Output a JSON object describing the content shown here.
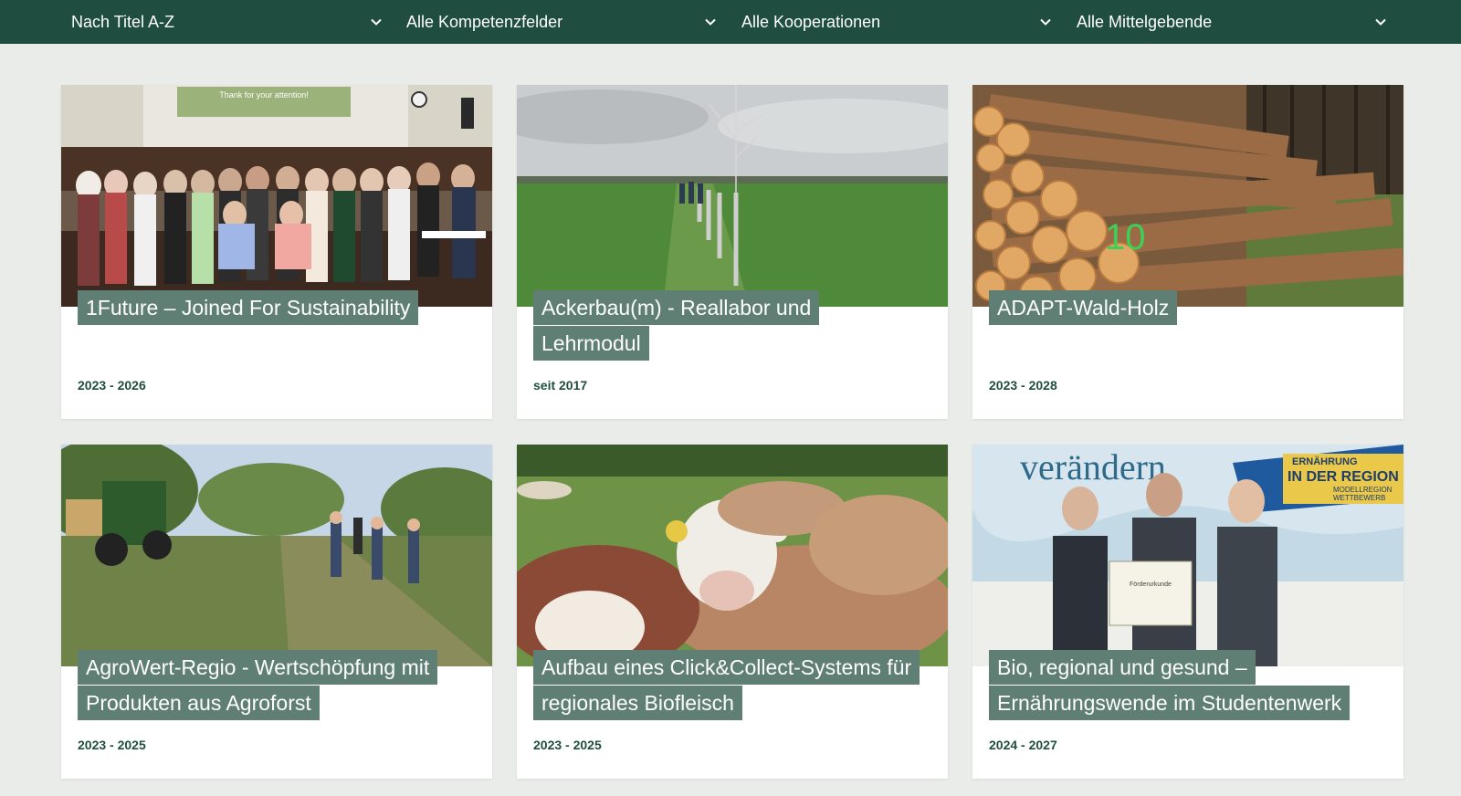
{
  "filters": {
    "sort": {
      "value": "Nach Titel A-Z",
      "icon": "chevron-down-icon"
    },
    "kompetenzfelder": {
      "value": "Alle Kompetenzfelder",
      "icon": "chevron-down-icon"
    },
    "kooperationen": {
      "value": "Alle Kooperationen",
      "icon": "chevron-down-icon"
    },
    "mittelgebende": {
      "value": "Alle Mittelgebende",
      "icon": "chevron-down-icon"
    }
  },
  "cards": [
    {
      "title": "1Future – Joined For Sustainability",
      "years": "2023 - 2026",
      "image_overlay_text": "Thank for your attention!"
    },
    {
      "title": "Ackerbau(m) - Reallabor und Lehrmodul",
      "years": "seit 2017"
    },
    {
      "title": "ADAPT-Wald-Holz",
      "years": "2023 - 2028"
    },
    {
      "title": "AgroWert-Regio - Wertschöpfung mit Produkten aus Agroforst",
      "years": "2023 - 2025"
    },
    {
      "title": "Aufbau eines Click&Collect-Systems für regionales Biofleisch",
      "years": "2023 - 2025"
    },
    {
      "title": "Bio, regional und gesund – Ernährungswende im Studentenwerk",
      "years": "2024 - 2027",
      "image_text": {
        "banner": "verändern.",
        "badge_line1": "ERNÄHRUNG",
        "badge_line2": "IN DER REGION",
        "badge_line3": "MODELLREGION",
        "badge_line4": "WETTBEWERB",
        "certificate": "Förderurkunde"
      }
    }
  ],
  "colors": {
    "header_bg": "#1f4d3f",
    "title_bg": "#5f7f74",
    "years_text": "#1f4d3f",
    "page_bg": "#eaecea"
  }
}
